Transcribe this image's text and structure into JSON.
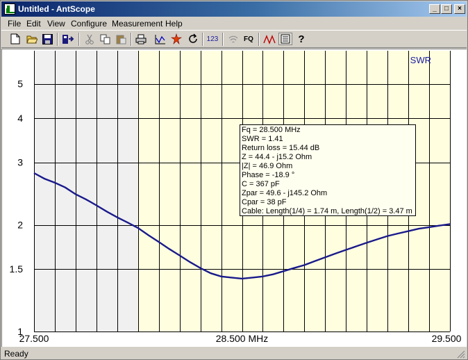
{
  "window": {
    "title": "Untitled - AntScope"
  },
  "menu": [
    "File",
    "Edit",
    "View",
    "Configure",
    "Measurement",
    "Help"
  ],
  "toolbar": {
    "items": [
      "new-icon",
      "open-icon",
      "save-icon",
      "export-icon",
      "cut-icon",
      "copy-icon",
      "paste-icon",
      "print-icon",
      "chart-icon",
      "scan-icon",
      "refresh-icon",
      "digits-icon",
      "wireless-icon",
      "frequency-icon",
      "cursor-icon",
      "info-icon",
      "help-icon"
    ],
    "digits_label": "123",
    "fq_label": "FQ"
  },
  "chart_data": {
    "type": "line",
    "series_label": "SWR",
    "xlabel": "28.500 MHz",
    "x_tick_labels": [
      "27.500",
      "28.500 MHz",
      "29.500"
    ],
    "xlim": [
      27.5,
      29.5
    ],
    "y_tick_labels": [
      "1",
      "1.5",
      "2",
      "3",
      "4",
      "5"
    ],
    "y_ticks": [
      1,
      1.5,
      2,
      3,
      4,
      5
    ],
    "ylim": [
      1,
      6.2
    ],
    "y_scale": "log",
    "grid": true,
    "band_shaded_from": 27.5,
    "band_shaded_to": 28.0,
    "colors": {
      "line": "#1a1a8c",
      "band_out": "#f0f0f0",
      "band_in": "#ffffe0",
      "grid": "#000000",
      "label": "#1a1aa0"
    },
    "series": [
      {
        "x": [
          27.5,
          27.55,
          27.6,
          27.65,
          27.7,
          27.75,
          27.8,
          27.85,
          27.9,
          27.95,
          28.0,
          28.05,
          28.1,
          28.15,
          28.2,
          28.25,
          28.3,
          28.35,
          28.4,
          28.45,
          28.5,
          28.55,
          28.6,
          28.65,
          28.7,
          28.75,
          28.8,
          28.85,
          28.9,
          28.95,
          29.0,
          29.05,
          29.1,
          29.15,
          29.2,
          29.25,
          29.3,
          29.35,
          29.4,
          29.45,
          29.5
        ],
        "y": [
          2.8,
          2.7,
          2.63,
          2.55,
          2.44,
          2.36,
          2.27,
          2.18,
          2.1,
          2.03,
          1.96,
          1.87,
          1.79,
          1.71,
          1.64,
          1.57,
          1.51,
          1.46,
          1.43,
          1.42,
          1.41,
          1.42,
          1.43,
          1.45,
          1.48,
          1.51,
          1.54,
          1.58,
          1.62,
          1.66,
          1.7,
          1.74,
          1.78,
          1.82,
          1.86,
          1.89,
          1.92,
          1.95,
          1.97,
          1.99,
          2.01
        ]
      }
    ]
  },
  "readout": [
    "Fq = 28.500 MHz",
    "SWR = 1.41",
    "Return loss = 15.44 dB",
    "Z = 44.4 - j15.2 Ohm",
    "|Z| = 46.9 Ohm",
    "Phase = -18.9 °",
    "C = 367 pF",
    "Zpar = 49.6 - j145.2 Ohm",
    "Cpar = 38 pF",
    "Cable: Length(1/4) = 1.74 m, Length(1/2) = 3.47 m"
  ],
  "status": {
    "text": "Ready"
  }
}
